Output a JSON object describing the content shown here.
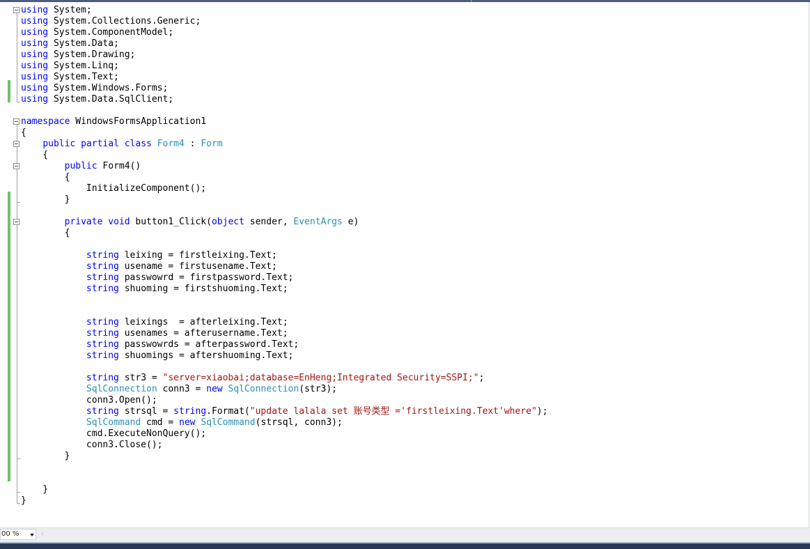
{
  "editor": {
    "lines": [
      [
        {
          "t": "using",
          "c": "kw"
        },
        {
          "t": " System;",
          "c": "pl"
        }
      ],
      [
        {
          "t": "using",
          "c": "kw"
        },
        {
          "t": " System.Collections.Generic;",
          "c": "pl"
        }
      ],
      [
        {
          "t": "using",
          "c": "kw"
        },
        {
          "t": " System.ComponentModel;",
          "c": "pl"
        }
      ],
      [
        {
          "t": "using",
          "c": "kw"
        },
        {
          "t": " System.Data;",
          "c": "pl"
        }
      ],
      [
        {
          "t": "using",
          "c": "kw"
        },
        {
          "t": " System.Drawing;",
          "c": "pl"
        }
      ],
      [
        {
          "t": "using",
          "c": "kw"
        },
        {
          "t": " System.Linq;",
          "c": "pl"
        }
      ],
      [
        {
          "t": "using",
          "c": "kw"
        },
        {
          "t": " System.Text;",
          "c": "pl"
        }
      ],
      [
        {
          "t": "using",
          "c": "kw"
        },
        {
          "t": " System.Windows.Forms;",
          "c": "pl"
        }
      ],
      [
        {
          "t": "using",
          "c": "kw"
        },
        {
          "t": " System.Data.SqlClient;",
          "c": "pl"
        }
      ],
      [],
      [
        {
          "t": "namespace",
          "c": "kw"
        },
        {
          "t": " WindowsFormsApplication1",
          "c": "pl"
        }
      ],
      [
        {
          "t": "{",
          "c": "pl"
        }
      ],
      [
        {
          "t": "    ",
          "c": "pl"
        },
        {
          "t": "public",
          "c": "kw"
        },
        {
          "t": " ",
          "c": "pl"
        },
        {
          "t": "partial",
          "c": "kw"
        },
        {
          "t": " ",
          "c": "pl"
        },
        {
          "t": "class",
          "c": "kw"
        },
        {
          "t": " ",
          "c": "pl"
        },
        {
          "t": "Form4",
          "c": "ty"
        },
        {
          "t": " : ",
          "c": "pl"
        },
        {
          "t": "Form",
          "c": "ty"
        }
      ],
      [
        {
          "t": "    {",
          "c": "pl"
        }
      ],
      [
        {
          "t": "        ",
          "c": "pl"
        },
        {
          "t": "public",
          "c": "kw"
        },
        {
          "t": " Form4()",
          "c": "pl"
        }
      ],
      [
        {
          "t": "        {",
          "c": "pl"
        }
      ],
      [
        {
          "t": "            InitializeComponent();",
          "c": "pl"
        }
      ],
      [
        {
          "t": "        }",
          "c": "pl"
        }
      ],
      [],
      [
        {
          "t": "        ",
          "c": "pl"
        },
        {
          "t": "private",
          "c": "kw"
        },
        {
          "t": " ",
          "c": "pl"
        },
        {
          "t": "void",
          "c": "kw"
        },
        {
          "t": " button1_Click(",
          "c": "pl"
        },
        {
          "t": "object",
          "c": "kw"
        },
        {
          "t": " sender, ",
          "c": "pl"
        },
        {
          "t": "EventArgs",
          "c": "ty"
        },
        {
          "t": " e)",
          "c": "pl"
        }
      ],
      [
        {
          "t": "        {",
          "c": "pl"
        }
      ],
      [],
      [
        {
          "t": "            ",
          "c": "pl"
        },
        {
          "t": "string",
          "c": "kw"
        },
        {
          "t": " leixing = firstleixing.Text;",
          "c": "pl"
        }
      ],
      [
        {
          "t": "            ",
          "c": "pl"
        },
        {
          "t": "string",
          "c": "kw"
        },
        {
          "t": " usename = firstusename.Text;",
          "c": "pl"
        }
      ],
      [
        {
          "t": "            ",
          "c": "pl"
        },
        {
          "t": "string",
          "c": "kw"
        },
        {
          "t": " passwowrd = firstpassword.Text;",
          "c": "pl"
        }
      ],
      [
        {
          "t": "            ",
          "c": "pl"
        },
        {
          "t": "string",
          "c": "kw"
        },
        {
          "t": " shuoming = firstshuoming.Text;",
          "c": "pl"
        }
      ],
      [],
      [],
      [
        {
          "t": "            ",
          "c": "pl"
        },
        {
          "t": "string",
          "c": "kw"
        },
        {
          "t": " leixings  = afterleixing.Text;",
          "c": "pl"
        }
      ],
      [
        {
          "t": "            ",
          "c": "pl"
        },
        {
          "t": "string",
          "c": "kw"
        },
        {
          "t": " usenames = afterusername.Text;",
          "c": "pl"
        }
      ],
      [
        {
          "t": "            ",
          "c": "pl"
        },
        {
          "t": "string",
          "c": "kw"
        },
        {
          "t": " passwowrds = afterpassword.Text;",
          "c": "pl"
        }
      ],
      [
        {
          "t": "            ",
          "c": "pl"
        },
        {
          "t": "string",
          "c": "kw"
        },
        {
          "t": " shuomings = aftershuoming.Text;",
          "c": "pl"
        }
      ],
      [],
      [
        {
          "t": "            ",
          "c": "pl"
        },
        {
          "t": "string",
          "c": "kw"
        },
        {
          "t": " str3 = ",
          "c": "pl"
        },
        {
          "t": "\"server=xiaobai;database=EnHeng;Integrated Security=SSPI;\"",
          "c": "st"
        },
        {
          "t": ";",
          "c": "pl"
        }
      ],
      [
        {
          "t": "            ",
          "c": "pl"
        },
        {
          "t": "SqlConnection",
          "c": "ty"
        },
        {
          "t": " conn3 = ",
          "c": "pl"
        },
        {
          "t": "new",
          "c": "kw"
        },
        {
          "t": " ",
          "c": "pl"
        },
        {
          "t": "SqlConnection",
          "c": "ty"
        },
        {
          "t": "(str3);",
          "c": "pl"
        }
      ],
      [
        {
          "t": "            conn3.Open();",
          "c": "pl"
        }
      ],
      [
        {
          "t": "            ",
          "c": "pl"
        },
        {
          "t": "string",
          "c": "kw"
        },
        {
          "t": " strsql = ",
          "c": "pl"
        },
        {
          "t": "string",
          "c": "kw"
        },
        {
          "t": ".Format(",
          "c": "pl"
        },
        {
          "t": "\"update lalala set 账号类型 ='firstleixing.Text'where\"",
          "c": "st"
        },
        {
          "t": ");",
          "c": "pl"
        }
      ],
      [
        {
          "t": "            ",
          "c": "pl"
        },
        {
          "t": "SqlCommand",
          "c": "ty"
        },
        {
          "t": " cmd = ",
          "c": "pl"
        },
        {
          "t": "new",
          "c": "kw"
        },
        {
          "t": " ",
          "c": "pl"
        },
        {
          "t": "SqlCommand",
          "c": "ty"
        },
        {
          "t": "(strsql, conn3);",
          "c": "pl"
        }
      ],
      [
        {
          "t": "            cmd.ExecuteNonQuery();",
          "c": "pl"
        }
      ],
      [
        {
          "t": "            conn3.Close();",
          "c": "pl"
        }
      ],
      [
        {
          "t": "        }",
          "c": "pl"
        }
      ],
      [],
      [],
      [
        {
          "t": "    }",
          "c": "pl"
        }
      ],
      [
        {
          "t": "}",
          "c": "pl"
        }
      ]
    ]
  },
  "status_bar": {
    "zoom": "00 %",
    "scroll_left_glyph": "‹"
  },
  "colors": {
    "keyword": "#0000ff",
    "type": "#2b91af",
    "string": "#a31515",
    "change_marker": "#6cc26c"
  }
}
